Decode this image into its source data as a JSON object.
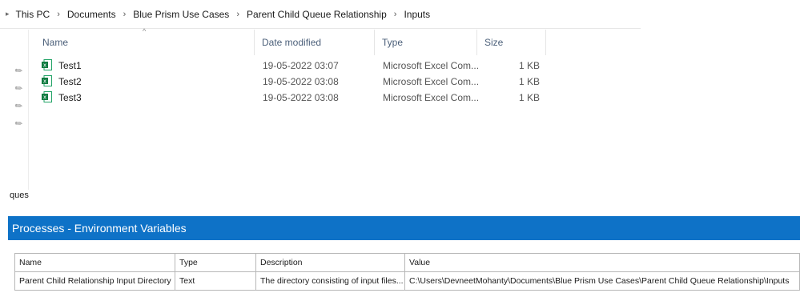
{
  "breadcrumb": {
    "items": [
      "This PC",
      "Documents",
      "Blue Prism Use Cases",
      "Parent Child Queue Relationship",
      "Inputs"
    ]
  },
  "file_list": {
    "columns": {
      "name": "Name",
      "date_modified": "Date modified",
      "type": "Type",
      "size": "Size"
    },
    "files": [
      {
        "name": "Test1",
        "date": "19-05-2022 03:07",
        "type": "Microsoft Excel Com...",
        "size": "1 KB"
      },
      {
        "name": "Test2",
        "date": "19-05-2022 03:08",
        "type": "Microsoft Excel Com...",
        "size": "1 KB"
      },
      {
        "name": "Test3",
        "date": "19-05-2022 03:08",
        "type": "Microsoft Excel Com...",
        "size": "1 KB"
      }
    ],
    "icon": "excel-file-icon"
  },
  "ques_text": "ques",
  "env_vars": {
    "title": "Processes - Environment Variables",
    "accent": "#0e72c7",
    "columns": {
      "name": "Name",
      "type": "Type",
      "description": "Description",
      "value": "Value"
    },
    "rows": [
      {
        "name": "Parent Child Relationship Input Directory",
        "type": "Text",
        "description": "The directory consisting of input files...",
        "value": "C:\\Users\\DevneetMohanty\\Documents\\Blue Prism Use Cases\\Parent Child Queue Relationship\\Inputs"
      }
    ]
  }
}
